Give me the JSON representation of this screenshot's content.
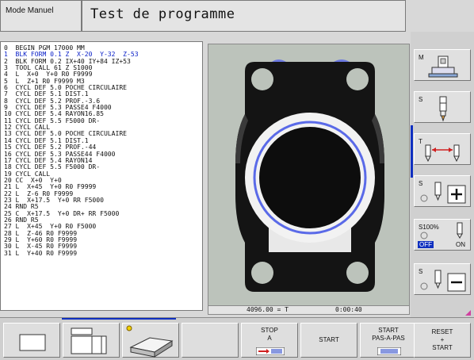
{
  "header": {
    "mode": "Mode Manuel",
    "title": "Test de programme"
  },
  "program": {
    "active_line": 1,
    "lines": [
      "0  BEGIN PGM 17000 MM",
      "1  BLK FORM 0.1 Z  X-20  Y-32  Z-53",
      "2  BLK FORM 0.2 IX+40 IY+84 IZ+53",
      "3  TOOL CALL 61 Z S1000",
      "4  L  X+0  Y+0 R0 F9999",
      "5  L  Z+1 R0 F9999 M3",
      "6  CYCL DEF 5.0 POCHE CIRCULAIRE",
      "7  CYCL DEF 5.1 DIST.1",
      "8  CYCL DEF 5.2 PROF.-3.6",
      "9  CYCL DEF 5.3 PASSE4 F4000",
      "10 CYCL DEF 5.4 RAYON16.85",
      "11 CYCL DEF 5.5 F5000 DR-",
      "12 CYCL CALL",
      "13 CYCL DEF 5.0 POCHE CIRCULAIRE",
      "14 CYCL DEF 5.1 DIST.1",
      "15 CYCL DEF 5.2 PROF.-44",
      "16 CYCL DEF 5.3 PASSE44 F4000",
      "17 CYCL DEF 5.4 RAYON14",
      "18 CYCL DEF 5.5 F5000 DR-",
      "19 CYCL CALL",
      "20 CC  X+0  Y+0",
      "21 L  X+45  Y+0 R0 F9999",
      "22 L  Z-6 R0 F9999",
      "23 L  X+17.5  Y+0 RR F5000",
      "24 RND R5",
      "25 C  X+17.5  Y+0 DR+ RR F5000",
      "26 RND R5",
      "27 L  X+45  Y+0 R0 F5000",
      "28 L  Z-46 R0 F9999",
      "29 L  Y+60 R0 F9999",
      "30 L  X-45 R0 F9999",
      "31 L  Y+40 R0 F9999"
    ]
  },
  "status": {
    "time_value": "4096.00 = T",
    "elapsed": "0:00:40"
  },
  "side_softkeys": {
    "m_label": "M",
    "s_label": "S",
    "t_label": "T",
    "s2_label": "S",
    "override_label": "S100%",
    "off_label": "OFF",
    "on_label": "ON",
    "s3_label": "S"
  },
  "bottom_softkeys": {
    "stop_line1": "STOP",
    "stop_line2": "A",
    "start": "START",
    "start_pas_line1": "START",
    "start_pas_line2": "PAS-A-PAS",
    "reset_line1": "RESET",
    "reset_line2": "+",
    "reset_line3": "START"
  },
  "colors": {
    "accent_blue": "#1030c0",
    "workpiece": "#111111",
    "background_sim": "#bcc3bb"
  }
}
